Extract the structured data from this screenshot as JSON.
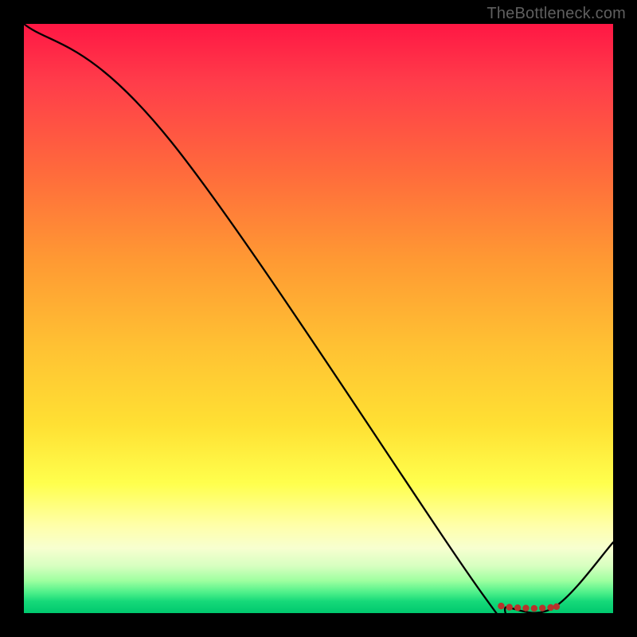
{
  "watermark": "TheBottleneck.com",
  "chart_data": {
    "type": "line",
    "title": "",
    "xlabel": "",
    "ylabel": "",
    "xlim": [
      0,
      100
    ],
    "ylim": [
      0,
      100
    ],
    "series": [
      {
        "name": "bottleneck-curve",
        "stroke": "#000000",
        "x": [
          0,
          25,
          78,
          82,
          90,
          100
        ],
        "values": [
          100,
          80,
          3,
          1,
          1,
          12
        ]
      }
    ],
    "markers": {
      "name": "optimal-range",
      "color": "#b7332b",
      "points": [
        {
          "x": 81,
          "y": 1.2
        },
        {
          "x": 82.4,
          "y": 1.0
        },
        {
          "x": 83.8,
          "y": 0.9
        },
        {
          "x": 85.2,
          "y": 0.85
        },
        {
          "x": 86.6,
          "y": 0.8
        },
        {
          "x": 88.0,
          "y": 0.85
        },
        {
          "x": 89.4,
          "y": 0.95
        },
        {
          "x": 90.4,
          "y": 1.1
        }
      ]
    }
  }
}
